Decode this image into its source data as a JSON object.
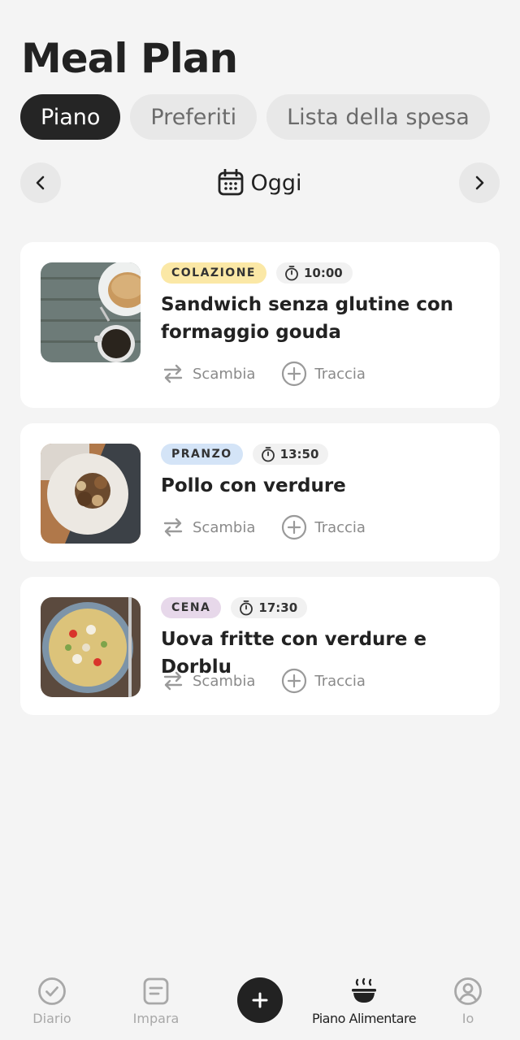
{
  "header": {
    "title": "Meal Plan"
  },
  "tabs": [
    {
      "label": "Piano",
      "active": true
    },
    {
      "label": "Preferiti",
      "active": false
    },
    {
      "label": "Lista della spesa",
      "active": false
    }
  ],
  "date": {
    "label": "Oggi",
    "icon": "calendar-icon"
  },
  "meals": [
    {
      "category": "COLAZIONE",
      "time": "10:00",
      "name": "Sandwich senza glutine con formaggio gouda",
      "swap_label": "Scambia",
      "track_label": "Traccia"
    },
    {
      "category": "PRANZO",
      "time": "13:50",
      "name": "Pollo con verdure",
      "swap_label": "Scambia",
      "track_label": "Traccia"
    },
    {
      "category": "CENA",
      "time": "17:30",
      "name": "Uova fritte con verdure e Dorblu",
      "swap_label": "Scambia",
      "track_label": "Traccia"
    }
  ],
  "colors": {
    "colazione": "#fbe8a6",
    "pranzo": "#d4e4f7",
    "cena": "#e7d8ea",
    "active_tab": "#252525"
  },
  "bottom_nav": [
    {
      "label": "Diario",
      "icon": "check-circle-icon",
      "active": false
    },
    {
      "label": "Impara",
      "icon": "document-icon",
      "active": false
    },
    {
      "label": "",
      "icon": "plus-icon",
      "active": false
    },
    {
      "label": "Piano Alimentare",
      "icon": "bowl-icon",
      "active": true
    },
    {
      "label": "Io",
      "icon": "user-circle-icon",
      "active": false
    }
  ]
}
